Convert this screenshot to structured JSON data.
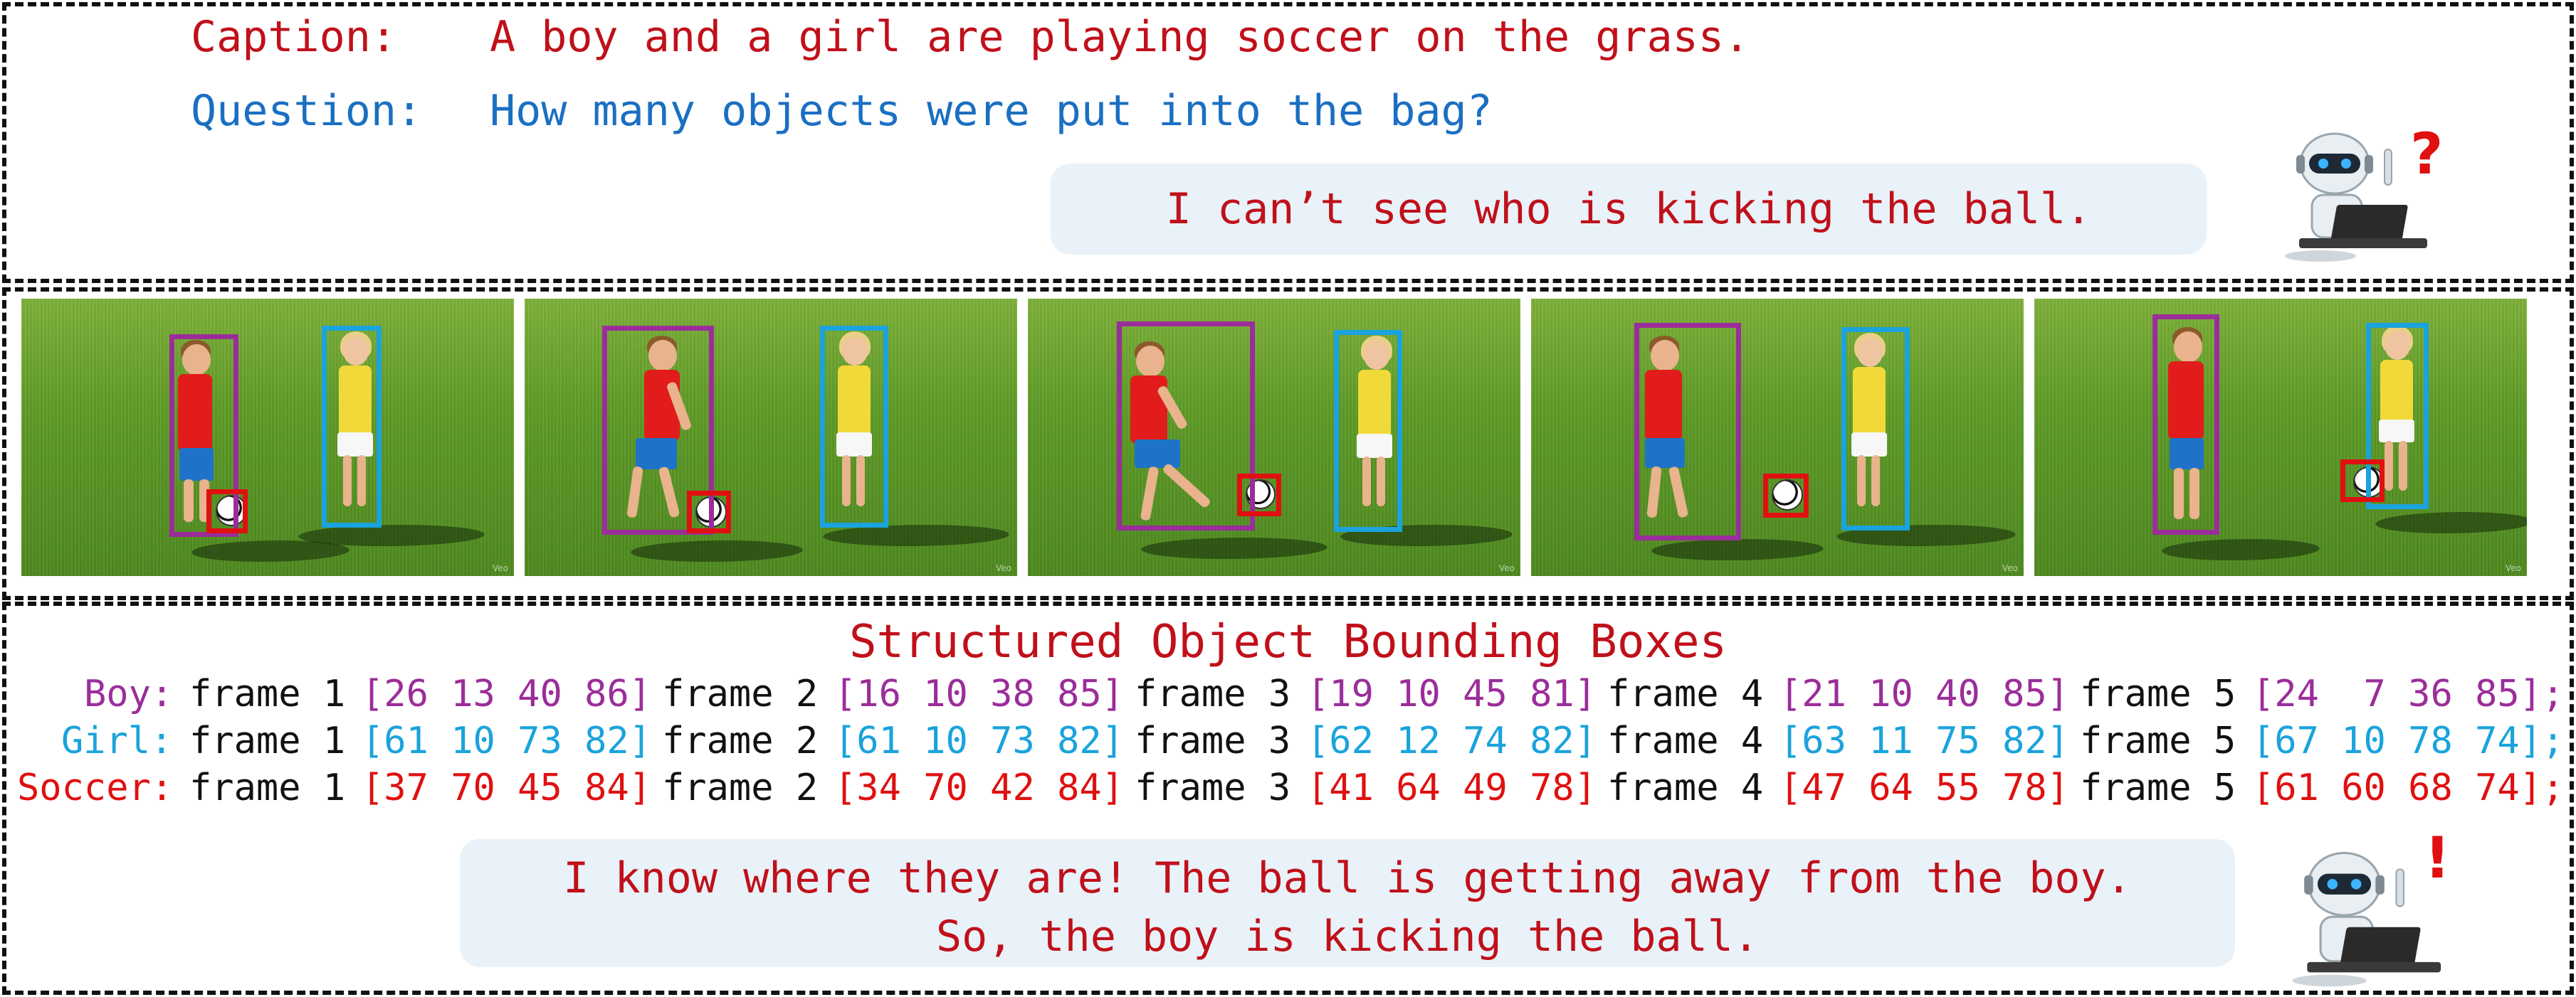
{
  "header": {
    "caption_label": "Caption:",
    "caption_text": "A boy and a girl are playing soccer on the grass.",
    "question_label": "Question:",
    "question_text": "How many objects were put into the bag?"
  },
  "bubbles": {
    "before": "I can’t see who is kicking the ball.",
    "after_line1": "I know where they are! The ball is getting away from the boy.",
    "after_line2": "So, the boy is kicking the ball."
  },
  "marks": {
    "question_mark": "?",
    "exclamation_mark": "!"
  },
  "frames_watermark": "Veo",
  "bbox_title": "Structured Object Bounding Boxes",
  "colors": {
    "boy": "#9b2d9a",
    "girl": "#1aa3dc",
    "soccer": "#e01010",
    "caption": "#c0101a",
    "question": "#1a6fc2"
  },
  "objects": [
    {
      "label": "Boy:",
      "color": "#9b2d9a",
      "frames": [
        {
          "name": "frame 1",
          "box": "[26 13 40 86]"
        },
        {
          "name": "frame 2",
          "box": "[16 10 38 85]"
        },
        {
          "name": "frame 3",
          "box": "[19 10 45 81]"
        },
        {
          "name": "frame 4",
          "box": "[21 10 40 85]"
        },
        {
          "name": "frame 5",
          "box": "[24  7 36 85];"
        }
      ]
    },
    {
      "label": "Girl:",
      "color": "#1aa3dc",
      "frames": [
        {
          "name": "frame 1",
          "box": "[61 10 73 82]"
        },
        {
          "name": "frame 2",
          "box": "[61 10 73 82]"
        },
        {
          "name": "frame 3",
          "box": "[62 12 74 82]"
        },
        {
          "name": "frame 4",
          "box": "[63 11 75 82]"
        },
        {
          "name": "frame 5",
          "box": "[67 10 78 74];"
        }
      ]
    },
    {
      "label": "Soccer:",
      "color": "#e01010",
      "frames": [
        {
          "name": "frame 1",
          "box": "[37 70 45 84]"
        },
        {
          "name": "frame 2",
          "box": "[34 70 42 84]"
        },
        {
          "name": "frame 3",
          "box": "[41 64 49 78]"
        },
        {
          "name": "frame 4",
          "box": "[47 64 55 78]"
        },
        {
          "name": "frame 5",
          "box": "[61 60 68 74];"
        }
      ]
    }
  ]
}
